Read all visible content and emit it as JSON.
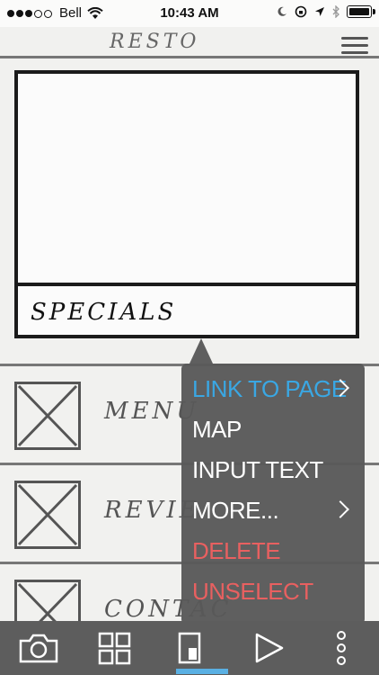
{
  "status_bar": {
    "carrier": "Bell",
    "time": "10:43 AM"
  },
  "sketch": {
    "brand": "RESTO",
    "specials_label": "SPECIALS",
    "rows": [
      {
        "label": "MENU"
      },
      {
        "label": "REVIE"
      },
      {
        "label": "CONTAC"
      }
    ]
  },
  "context_menu": {
    "items": [
      {
        "label": "LINK TO PAGE",
        "color": "#3aa7e3",
        "has_submenu": true
      },
      {
        "label": "MAP",
        "color": "#ffffff",
        "has_submenu": false
      },
      {
        "label": "INPUT TEXT",
        "color": "#ffffff",
        "has_submenu": false
      },
      {
        "label": "MORE...",
        "color": "#ffffff",
        "has_submenu": true
      },
      {
        "label": "DELETE",
        "color": "#e86060",
        "has_submenu": false
      },
      {
        "label": "UNSELECT",
        "color": "#e86060",
        "has_submenu": false
      }
    ]
  },
  "toolbar": {
    "tools": [
      {
        "icon": "camera-icon"
      },
      {
        "icon": "grid-icon"
      },
      {
        "icon": "page-icon",
        "active": true
      },
      {
        "icon": "play-icon"
      },
      {
        "icon": "more-icon"
      }
    ],
    "accent_color": "#5ab0e3"
  }
}
